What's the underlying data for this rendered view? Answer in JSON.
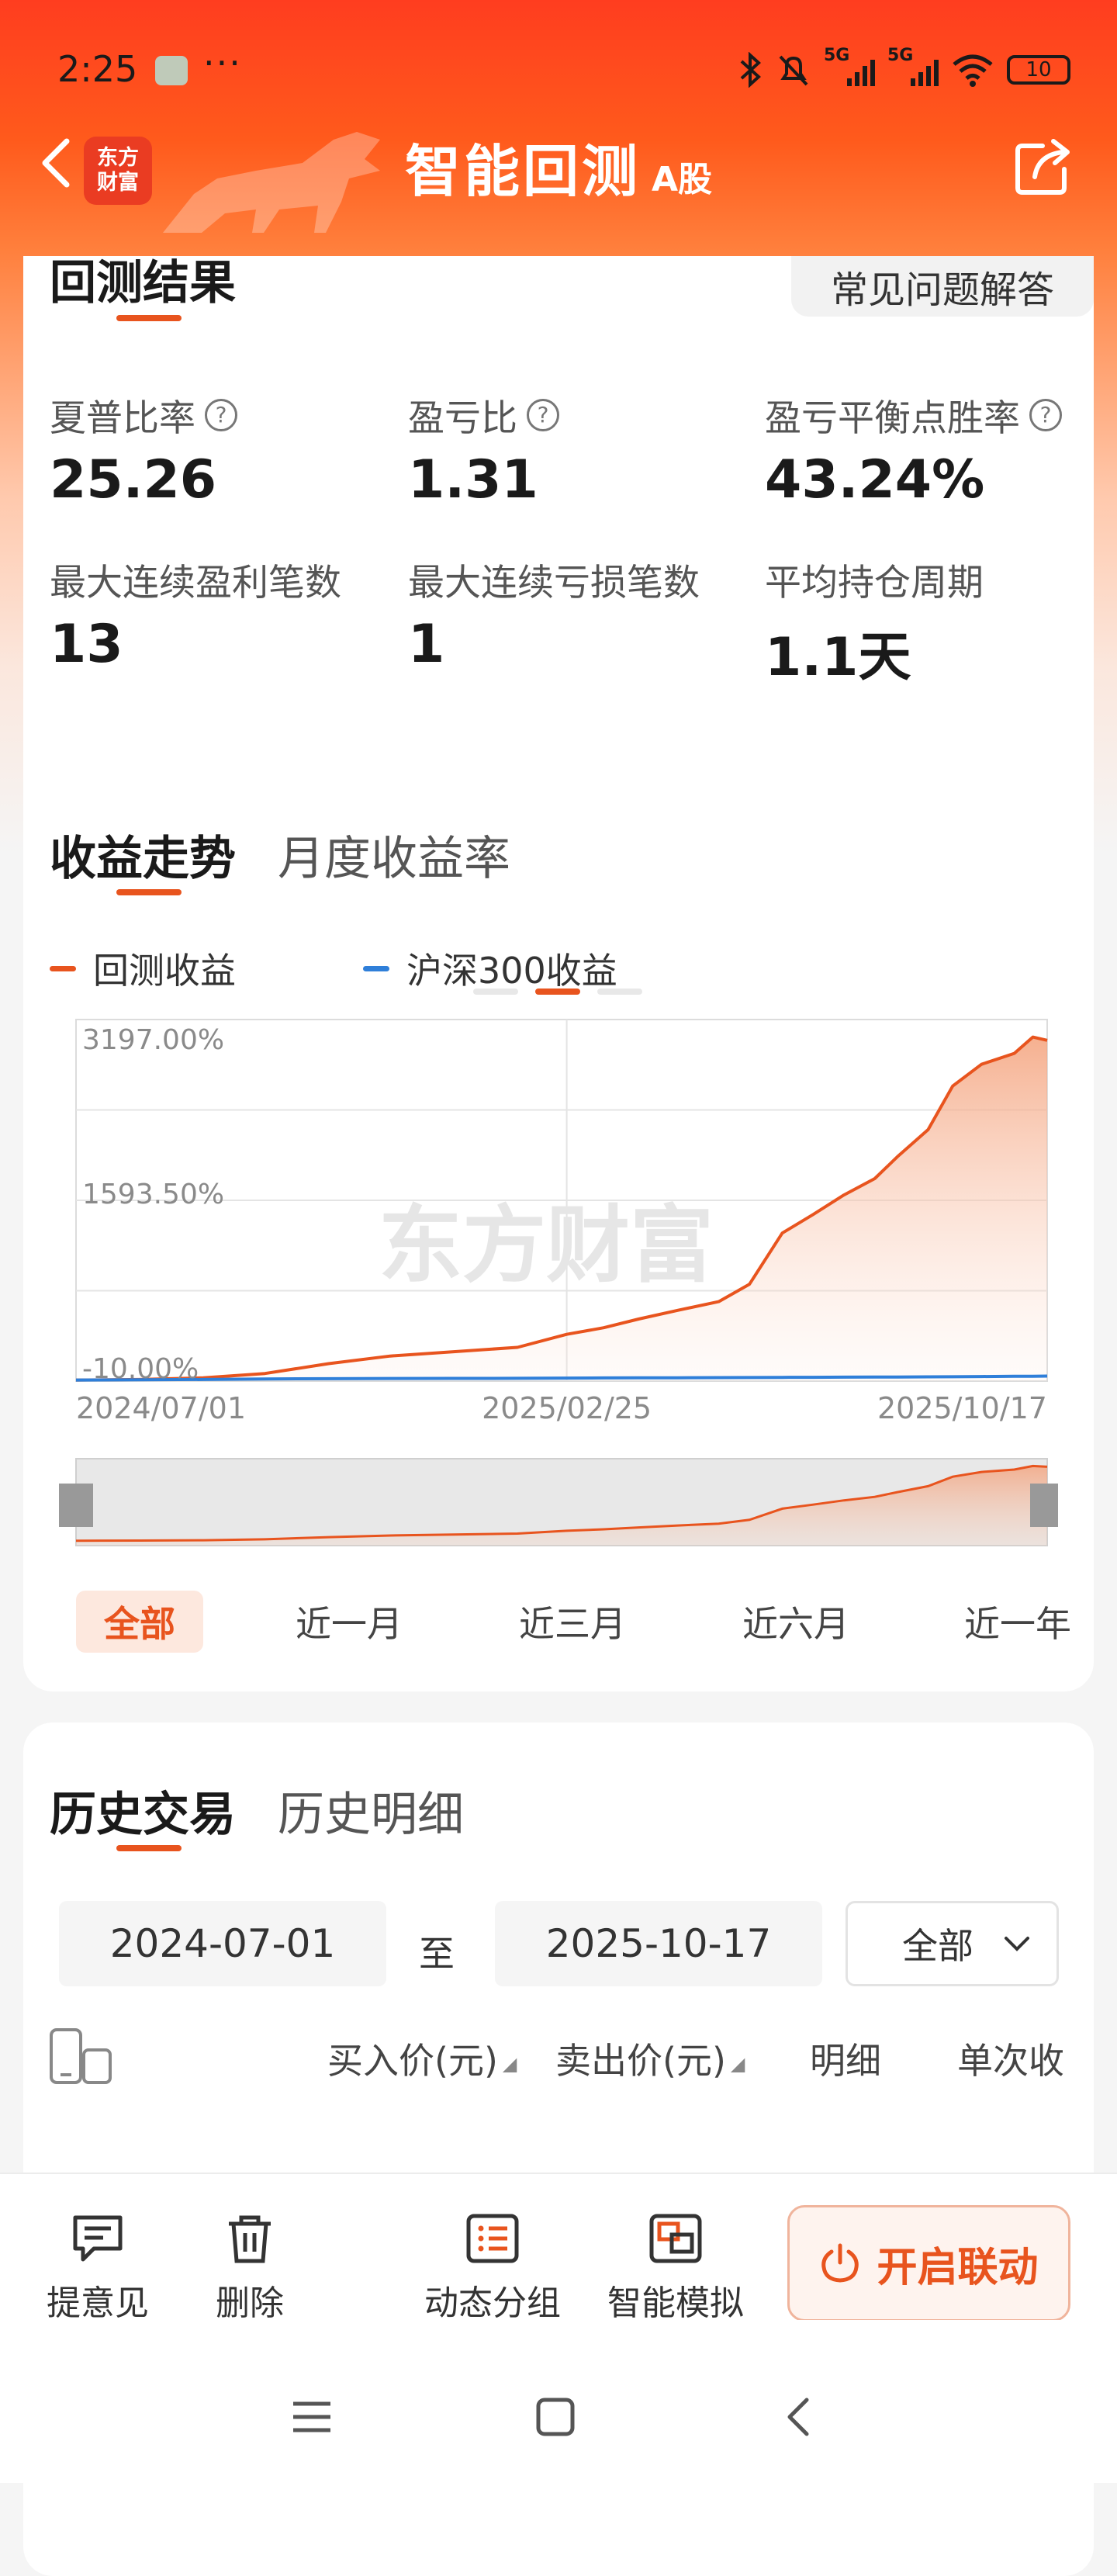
{
  "status_bar": {
    "time": "2:25",
    "dots": "···",
    "battery": "10",
    "net_labels": [
      "5G",
      "5G"
    ]
  },
  "nav": {
    "title": "智能回测",
    "subtitle": "A股",
    "logo_line1": "东方",
    "logo_line2": "财富"
  },
  "results": {
    "title": "回测结果",
    "faq": "常见问题解答",
    "metrics": [
      {
        "label": "夏普比率",
        "value": "25.26",
        "help": true
      },
      {
        "label": "盈亏比",
        "value": "1.31",
        "help": true
      },
      {
        "label": "盈亏平衡点胜率",
        "value": "43.24%",
        "help": true
      },
      {
        "label": "最大连续盈利笔数",
        "value": "13",
        "help": false
      },
      {
        "label": "最大连续亏损笔数",
        "value": "1",
        "help": false
      },
      {
        "label": "平均持仓周期",
        "value": "1.1天",
        "help": false
      }
    ]
  },
  "trend": {
    "tab_active": "收益走势",
    "tab_other": "月度收益率",
    "legend": [
      {
        "name": "回测收益",
        "color": "#e8541e"
      },
      {
        "name": "沪深300收益",
        "color": "#2f7fd9"
      }
    ],
    "watermark": "东方财富",
    "ranges": [
      "全部",
      "近一月",
      "近三月",
      "近六月",
      "近一年"
    ]
  },
  "chart_data": {
    "type": "area",
    "yticks": [
      "3197.00%",
      "1593.50%",
      "-10.00%"
    ],
    "xticks": [
      "2024/07/01",
      "2025/02/25",
      "2025/10/17"
    ],
    "ylim": [
      -10,
      3197
    ],
    "x": [
      "2024/07/01",
      "2024/08/01",
      "2024/09/01",
      "2024/10/01",
      "2024/11/01",
      "2024/12/01",
      "2025/01/01",
      "2025/02/01",
      "2025/02/25",
      "2025/03/15",
      "2025/04/01",
      "2025/04/20",
      "2025/05/10",
      "2025/05/25",
      "2025/06/10",
      "2025/06/25",
      "2025/07/10",
      "2025/07/25",
      "2025/08/05",
      "2025/08/20",
      "2025/09/01",
      "2025/09/15",
      "2025/10/01",
      "2025/10/10",
      "2025/10/17"
    ],
    "series": [
      {
        "name": "回测收益",
        "color": "#e8541e",
        "values": [
          0,
          5,
          20,
          60,
          150,
          220,
          260,
          300,
          420,
          480,
          560,
          640,
          720,
          880,
          1350,
          1520,
          1700,
          1850,
          2050,
          2300,
          2700,
          2900,
          3000,
          3150,
          3120
        ]
      },
      {
        "name": "沪深300收益",
        "color": "#2f7fd9",
        "values": [
          0,
          2,
          5,
          10,
          12,
          14,
          15,
          16,
          18,
          19,
          20,
          21,
          22,
          23,
          24,
          25,
          26,
          27,
          28,
          29,
          30,
          32,
          34,
          35,
          36
        ]
      }
    ],
    "grid": true,
    "legend": "top-left"
  },
  "history": {
    "tab_active": "历史交易",
    "tab_other": "历史明细",
    "date_from": "2024-07-01",
    "date_to": "2025-10-17",
    "to_label": "至",
    "filter": "全部",
    "columns": [
      "买入价(元)",
      "卖出价(元)",
      "明细",
      "单次收"
    ]
  },
  "toolbar": {
    "feedback": "提意见",
    "delete": "删除",
    "dynamic_group": "动态分组",
    "smart_sim": "智能模拟",
    "link": "开启联动"
  }
}
